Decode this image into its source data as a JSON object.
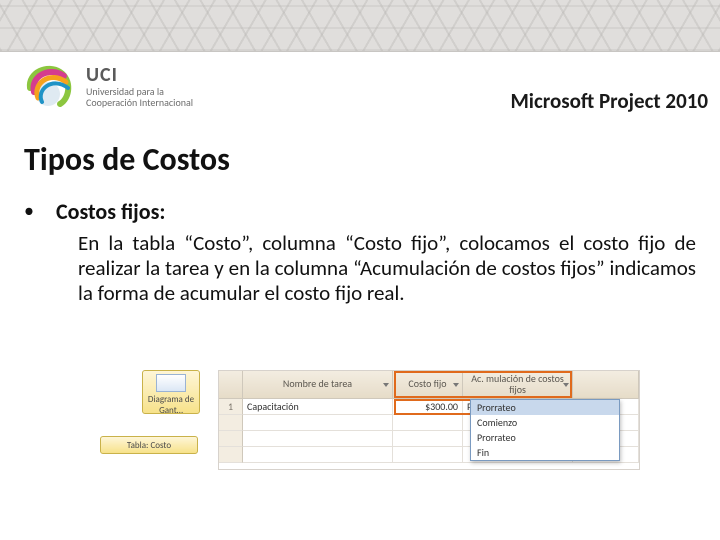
{
  "header": {
    "product": "Microsoft Project 2010",
    "logo_brand": "UCI",
    "logo_sub1": "Universidad para la",
    "logo_sub2": "Cooperación Internacional"
  },
  "title": "Tipos de Costos",
  "bullet": {
    "label": "Costos fijos:",
    "body": "En la tabla “Costo”, columna “Costo fijo”, colocamos el costo fijo de realizar la tarea y en la columna “Acumulación de costos fijos” indicamos la forma de acumular el costo fijo real."
  },
  "figure": {
    "ribbon_diagram": "Diagrama de Gant…",
    "ribbon_tabla": "Tabla: Costo",
    "columns": {
      "name": "Nombre de tarea",
      "fijo": "Costo fijo",
      "acum": "Ac. mulación de costos fijos"
    },
    "row": {
      "id": "1",
      "name": "Capacitación",
      "fijo": "$300.00",
      "acum": "Prorrateo"
    },
    "dropdown": {
      "opt1": "Comienzo",
      "opt2": "Prorrateo",
      "opt3": "Fin"
    }
  }
}
